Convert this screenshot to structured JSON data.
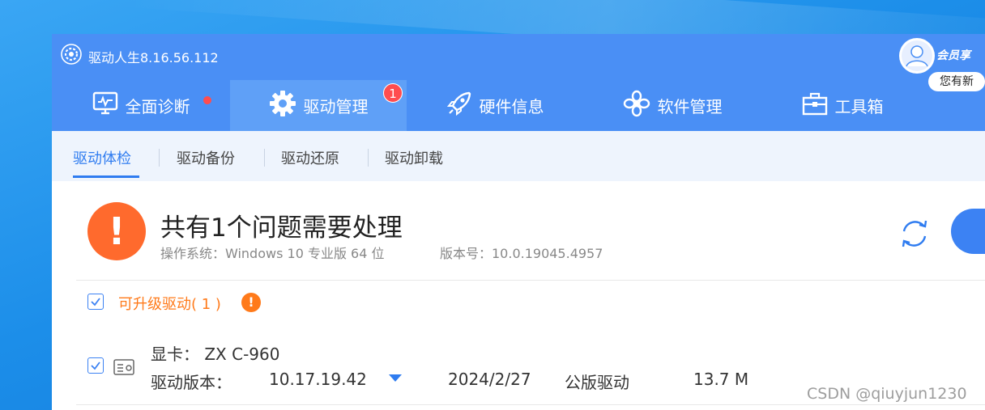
{
  "app": {
    "title": "驱动人生8.16.56.112",
    "vip_tag": "会员享",
    "message_bubble": "您有新"
  },
  "tabs": [
    {
      "label": "全面诊断",
      "icon": "monitor-icon"
    },
    {
      "label": "驱动管理",
      "icon": "gear-icon",
      "badge": "1"
    },
    {
      "label": "硬件信息",
      "icon": "rocket-icon"
    },
    {
      "label": "软件管理",
      "icon": "flower-icon"
    },
    {
      "label": "工具箱",
      "icon": "toolbox-icon"
    }
  ],
  "subnav": [
    "驱动体检",
    "驱动备份",
    "驱动还原",
    "驱动卸载"
  ],
  "summary": {
    "title": "共有1个问题需要处理",
    "os": "操作系统：Windows 10 专业版 64 位",
    "version": "版本号：10.0.19045.4957",
    "warning_mark": "!"
  },
  "section": {
    "label": "可升级驱动( 1 )",
    "warning_mark": "!"
  },
  "driver": {
    "name": "显卡： ZX C-960",
    "version_label": "驱动版本：",
    "version": "10.17.19.42",
    "date": "2024/2/27",
    "type": "公版驱动",
    "size": "13.7 M"
  },
  "watermark": "CSDN @qiuyjun1230",
  "colors": {
    "header": "#4a8ff5",
    "active_tab": "#5fa0f7",
    "accent": "#2f7cf0",
    "warning": "#ff6a2d",
    "badge": "#ff4d4f"
  }
}
